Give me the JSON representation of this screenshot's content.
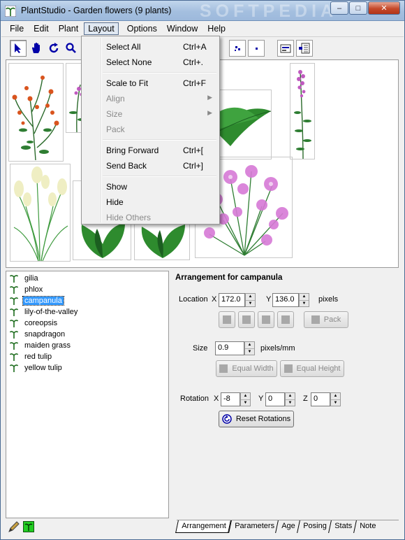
{
  "window": {
    "title": "PlantStudio - Garden flowers (9 plants)",
    "watermark": "SOFTPEDIA",
    "controls": {
      "minimize": "–",
      "maximize": "□",
      "close": "✕"
    }
  },
  "menubar": {
    "items": [
      "File",
      "Edit",
      "Plant",
      "Layout",
      "Options",
      "Window",
      "Help"
    ],
    "open": "Layout"
  },
  "layout_menu": {
    "items": [
      {
        "label": "Select All",
        "shortcut": "Ctrl+A",
        "enabled": true,
        "submenu": false
      },
      {
        "label": "Select None",
        "shortcut": "Ctrl+.",
        "enabled": true,
        "submenu": false
      },
      {
        "label": "Scale to Fit",
        "shortcut": "Ctrl+F",
        "enabled": true,
        "submenu": false
      },
      {
        "label": "Align",
        "shortcut": "",
        "enabled": false,
        "submenu": true
      },
      {
        "label": "Size",
        "shortcut": "",
        "enabled": false,
        "submenu": true
      },
      {
        "label": "Pack",
        "shortcut": "",
        "enabled": false,
        "submenu": false
      },
      {
        "label": "Bring Forward",
        "shortcut": "Ctrl+[",
        "enabled": true,
        "submenu": false
      },
      {
        "label": "Send Back",
        "shortcut": "Ctrl+]",
        "enabled": true,
        "submenu": false
      },
      {
        "label": "Show",
        "shortcut": "",
        "enabled": true,
        "submenu": false
      },
      {
        "label": "Hide",
        "shortcut": "",
        "enabled": true,
        "submenu": false
      },
      {
        "label": "Hide Others",
        "shortcut": "",
        "enabled": false,
        "submenu": false
      }
    ]
  },
  "toolbar": {
    "tools": [
      "select-arrow-icon",
      "hand-icon",
      "rotate-icon",
      "magnifier-icon"
    ],
    "selected_tool": "select-arrow-icon"
  },
  "plants": {
    "items": [
      "gilia",
      "phlox",
      "campanula",
      "lily-of-the-valley",
      "coreopsis",
      "snapdragon",
      "maiden grass",
      "red tulip",
      "yellow tulip"
    ],
    "selected": "campanula"
  },
  "arrangement": {
    "title": "Arrangement for campanula",
    "location_label": "Location",
    "x_label": "X",
    "x_value": "172.0",
    "y_label": "Y",
    "y_value": "136.0",
    "location_unit": "pixels",
    "pack_button": "Pack",
    "size_label": "Size",
    "size_value": "0.9",
    "size_unit": "pixels/mm",
    "equal_width_button": "Equal Width",
    "equal_height_button": "Equal Height",
    "rotation_label": "Rotation",
    "rot_x_label": "X",
    "rot_x_value": "-8",
    "rot_y_label": "Y",
    "rot_y_value": "0",
    "rot_z_label": "Z",
    "rot_z_value": "0",
    "reset_button": "Reset Rotations"
  },
  "tabs": {
    "items": [
      "Arrangement",
      "Parameters",
      "Age",
      "Posing",
      "Stats",
      "Note"
    ],
    "active": "Arrangement"
  },
  "colors": {
    "selection": "#3399ff",
    "leaf_green": "#2e7d32",
    "flower_pink": "#d77ad6",
    "flower_orange": "#d9541e"
  }
}
